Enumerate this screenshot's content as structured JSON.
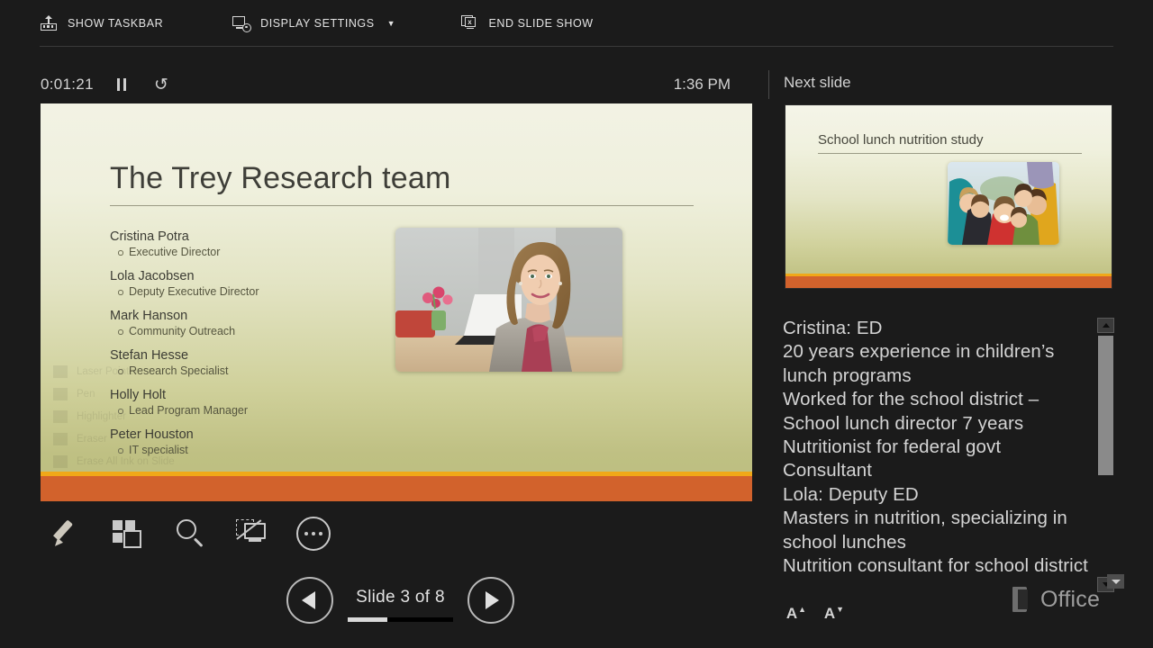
{
  "topbar": {
    "items": [
      {
        "label": "SHOW TASKBAR",
        "icon": "taskbar-icon",
        "caret": ""
      },
      {
        "label": "DISPLAY SETTINGS",
        "icon": "display-settings-icon",
        "caret": "▼"
      },
      {
        "label": "END SLIDE SHOW",
        "icon": "end-slideshow-icon",
        "caret": ""
      }
    ]
  },
  "timer": {
    "elapsed": "0:01:21",
    "pause_icon": "pause-icon",
    "reset_icon": "reset-icon",
    "clock": "1:36 PM"
  },
  "current_slide": {
    "title": "The Trey Research team",
    "team": [
      {
        "name": "Cristina Potra",
        "role": "Executive Director"
      },
      {
        "name": "Lola Jacobsen",
        "role": "Deputy Executive Director"
      },
      {
        "name": "Mark Hanson",
        "role": "Community Outreach"
      },
      {
        "name": "Stefan Hesse",
        "role": "Research Specialist"
      },
      {
        "name": "Holly Holt",
        "role": "Lead Program Manager"
      },
      {
        "name": "Peter Houston",
        "role": "IT specialist"
      }
    ],
    "photo_alt": "businesswoman-portrait",
    "accent_band": "#d2622c",
    "accent_line": "#f0a818"
  },
  "ghost_menu": {
    "items": [
      {
        "label": "Laser Pointer",
        "icon": "laser-pointer-icon"
      },
      {
        "label": "Pen",
        "icon": "pen-icon"
      },
      {
        "label": "Highlighter",
        "icon": "highlighter-icon"
      },
      {
        "label": "Eraser",
        "icon": "eraser-icon"
      },
      {
        "label": "Erase All Ink on Slide",
        "icon": "erase-all-icon"
      }
    ]
  },
  "ink_toolbar": {
    "buttons": [
      {
        "name": "pen-tools-button",
        "icon": "pen-icon"
      },
      {
        "name": "see-all-slides-button",
        "icon": "grid-icon"
      },
      {
        "name": "zoom-into-slide-button",
        "icon": "magnifier-icon"
      },
      {
        "name": "black-screen-button",
        "icon": "black-screen-icon"
      },
      {
        "name": "more-options-button",
        "icon": "ellipsis-icon"
      }
    ]
  },
  "navigation": {
    "previous_label": "Previous slide",
    "next_label": "Next slide",
    "counter": "Slide 3 of 8",
    "current": 3,
    "total": 8,
    "progress_percent": 37.5
  },
  "next_slide": {
    "header": "Next slide",
    "title": "School lunch nutrition study",
    "photo_alt": "children-group-huddle",
    "accent_band": "#d2622c",
    "accent_line": "#f0a818"
  },
  "notes": {
    "lines": [
      "Cristina: ED",
      "20 years experience in children’s lunch programs",
      "Worked for the school district – School lunch director 7 years",
      "Nutritionist for federal govt",
      "Consultant",
      "Lola: Deputy ED",
      "Masters in nutrition, specializing in school lunches",
      "Nutrition consultant for school district"
    ],
    "font_larger_label": "A",
    "font_smaller_label": "A"
  },
  "branding": {
    "office_label": "Office"
  }
}
